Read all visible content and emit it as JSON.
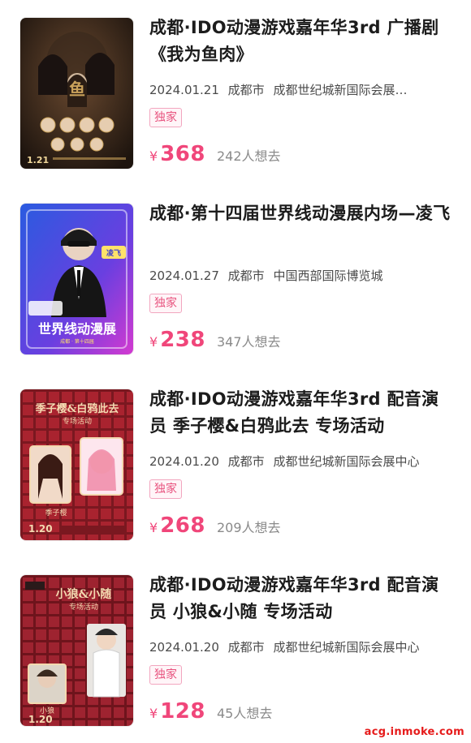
{
  "events": [
    {
      "title": "成都·IDO动漫游戏嘉年华3rd 广播剧《我为鱼肉》",
      "date": "2024.01.21",
      "city": "成都市",
      "venue": "成都世纪城新国际会展…",
      "badge": "独家",
      "currency": "¥",
      "price": "368",
      "interest": "242人想去",
      "poster": {
        "theme": "dark-gold",
        "date_text": "1.21",
        "colors": {
          "bg": "#2a1f17",
          "accent": "#c9a15a",
          "glow": "#5a3e28"
        }
      }
    },
    {
      "title": "成都·第十四届世界线动漫展内场—凌飞",
      "date": "2024.01.27",
      "city": "成都市",
      "venue": "中国西部国际博览城",
      "badge": "独家",
      "currency": "¥",
      "price": "238",
      "interest": "347人想去",
      "poster": {
        "theme": "blue-purple",
        "date_text": "",
        "colors": {
          "bg": "#3c3fd1",
          "accent": "#ff6fd8",
          "glow": "#8a5cf0"
        }
      }
    },
    {
      "title": "成都·IDO动漫游戏嘉年华3rd 配音演员 季子樱&白鸦此去 专场活动",
      "date": "2024.01.20",
      "city": "成都市",
      "venue": "成都世纪城新国际会展中心",
      "badge": "独家",
      "currency": "¥",
      "price": "268",
      "interest": "209人想去",
      "poster": {
        "theme": "red-plaid",
        "date_text": "1.20",
        "colors": {
          "bg": "#a9232f",
          "accent": "#f3d9b0",
          "glow": "#7a1820"
        }
      }
    },
    {
      "title": "成都·IDO动漫游戏嘉年华3rd 配音演员 小狼&小随 专场活动",
      "date": "2024.01.20",
      "city": "成都市",
      "venue": "成都世纪城新国际会展中心",
      "badge": "独家",
      "currency": "¥",
      "price": "128",
      "interest": "45人想去",
      "poster": {
        "theme": "red-plaid",
        "date_text": "1.20",
        "colors": {
          "bg": "#9e2330",
          "accent": "#f3d9b0",
          "glow": "#6e141c"
        }
      }
    }
  ],
  "watermark": "acg.inmoke.com"
}
